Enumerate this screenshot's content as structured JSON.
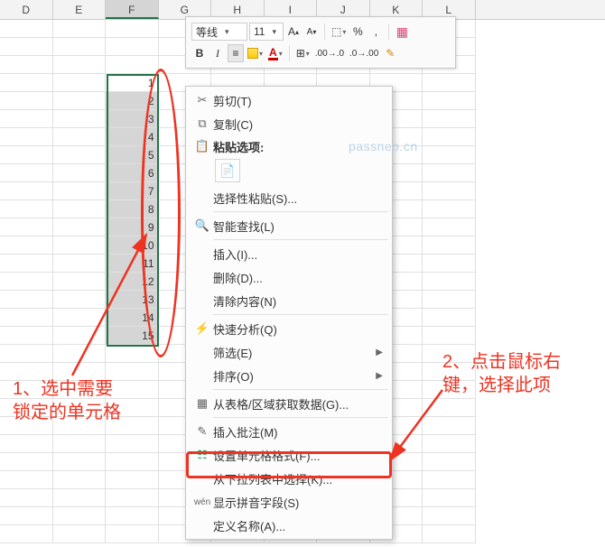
{
  "columns": [
    "D",
    "E",
    "F",
    "G",
    "H",
    "I",
    "J",
    "K",
    "L"
  ],
  "selectedColumn": "F",
  "cellValues": [
    1,
    2,
    3,
    4,
    5,
    6,
    7,
    8,
    9,
    10,
    11,
    12,
    13,
    14,
    15
  ],
  "miniToolbar": {
    "fontName": "等线",
    "fontSize": "11",
    "increaseFont": "A",
    "decreaseFont": "A",
    "percent": "%",
    "thousands": ",",
    "bold": "B",
    "italic": "I"
  },
  "contextMenu": {
    "cut": "剪切(T)",
    "copy": "复制(C)",
    "pasteHeader": "粘贴选项:",
    "pasteSpecial": "选择性粘贴(S)...",
    "smartLookup": "智能查找(L)",
    "insert": "插入(I)...",
    "delete": "删除(D)...",
    "clear": "清除内容(N)",
    "quickAnalysis": "快速分析(Q)",
    "filter": "筛选(E)",
    "sort": "排序(O)",
    "getFromTable": "从表格/区域获取数据(G)...",
    "insertComment": "插入批注(M)",
    "formatCells": "设置单元格格式(F)...",
    "pickFromList": "从下拉列表中选择(K)...",
    "showPinyin": "显示拼音字段(S)",
    "defineName": "定义名称(A)..."
  },
  "watermark": "passneo.cn",
  "annotation1": {
    "line1": "1、选中需要",
    "line2": "锁定的单元格"
  },
  "annotation2": {
    "line1": "2、点击鼠标右",
    "line2": "键，选择此项"
  }
}
